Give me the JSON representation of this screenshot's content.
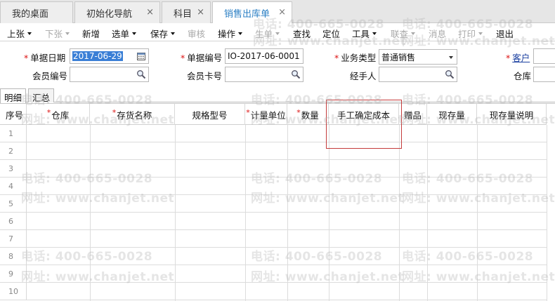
{
  "tabs": [
    {
      "label": "我的桌面",
      "closable": false,
      "active": false
    },
    {
      "label": "初始化导航",
      "closable": true,
      "active": false
    },
    {
      "label": "科目",
      "closable": true,
      "active": false
    },
    {
      "label": "销售出库单",
      "closable": true,
      "active": true
    }
  ],
  "close_glyph": "×",
  "toolbar": [
    {
      "label": "上张",
      "dropdown": true,
      "enabled": true
    },
    {
      "label": "下张",
      "dropdown": true,
      "enabled": false
    },
    {
      "label": "新增",
      "dropdown": false,
      "enabled": true
    },
    {
      "label": "选单",
      "dropdown": true,
      "enabled": true
    },
    {
      "label": "保存",
      "dropdown": true,
      "enabled": true
    },
    {
      "label": "审核",
      "dropdown": false,
      "enabled": false
    },
    {
      "label": "操作",
      "dropdown": true,
      "enabled": true
    },
    {
      "label": "生单",
      "dropdown": true,
      "enabled": false
    },
    {
      "label": "查找",
      "dropdown": false,
      "enabled": true
    },
    {
      "label": "定位",
      "dropdown": false,
      "enabled": true
    },
    {
      "label": "工具",
      "dropdown": true,
      "enabled": true
    },
    {
      "label": "联查",
      "dropdown": true,
      "enabled": false
    },
    {
      "label": "消息",
      "dropdown": false,
      "enabled": false
    },
    {
      "label": "打印",
      "dropdown": true,
      "enabled": false
    },
    {
      "label": "退出",
      "dropdown": false,
      "enabled": true
    }
  ],
  "form": {
    "doc_date_label": "单据日期",
    "doc_date_value": "2017-06-29",
    "doc_no_label": "单据编号",
    "doc_no_value": "IO-2017-06-0001",
    "biz_type_label": "业务类型",
    "biz_type_value": "普通销售",
    "customer_label": "客户",
    "member_no_label": "会员编号",
    "member_card_label": "会员卡号",
    "handler_label": "经手人",
    "warehouse_label": "仓库",
    "required_mark": "*"
  },
  "subtabs": [
    "明细",
    "汇总"
  ],
  "grid": {
    "required_mark": "*",
    "columns": [
      {
        "label": "序号",
        "required": false
      },
      {
        "label": "仓库",
        "required": true
      },
      {
        "label": "存货名称",
        "required": true
      },
      {
        "label": "规格型号",
        "required": false
      },
      {
        "label": "计量单位",
        "required": true
      },
      {
        "label": "数量",
        "required": true
      },
      {
        "label": "手工确定成本",
        "required": false
      },
      {
        "label": "赠品",
        "required": false
      },
      {
        "label": "现存量",
        "required": false
      },
      {
        "label": "现存量说明",
        "required": false
      }
    ],
    "row_numbers": [
      "1",
      "2",
      "3",
      "4",
      "5",
      "6",
      "7",
      "8",
      "9",
      "10"
    ]
  },
  "watermark": {
    "phone": "电话: 400-665-0028",
    "site": "网址: www.chanjet.net"
  },
  "colors": {
    "accent": "#2b7fc4",
    "highlight": "#c43b3b",
    "required": "#dd1111"
  },
  "icons": {
    "calendar": "calendar-icon",
    "lookup": "magnifier-icon",
    "dropdown": "chevron-down-icon",
    "close": "close-icon"
  }
}
